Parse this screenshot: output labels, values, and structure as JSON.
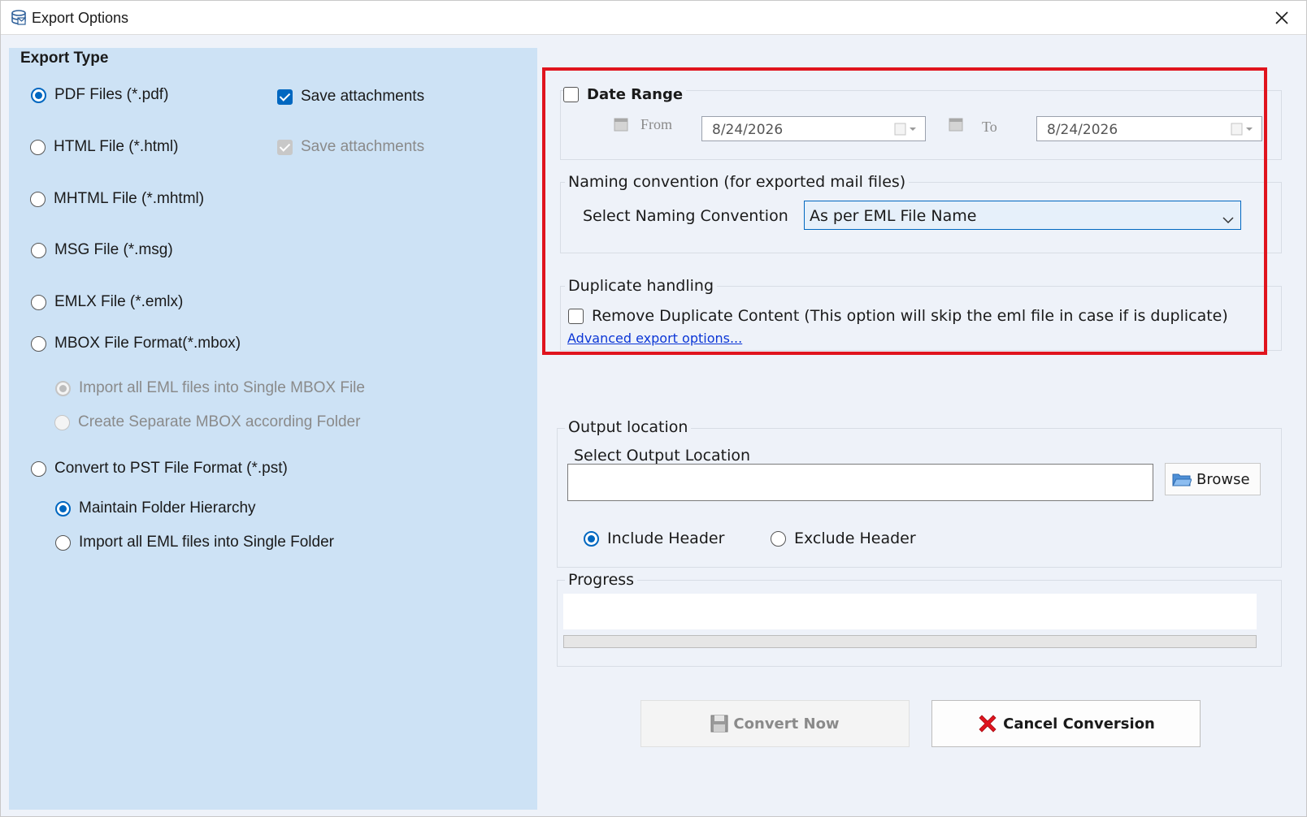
{
  "window": {
    "title": "Export Options"
  },
  "export_type": {
    "title": "Export Type",
    "pdf": {
      "label": "PDF Files (*.pdf)",
      "selected": true
    },
    "pdf_save_attachments": {
      "label": "Save attachments",
      "checked": true
    },
    "html": {
      "label": "HTML File  (*.html)",
      "selected": false
    },
    "html_save_attachments": {
      "label": "Save attachments",
      "checked": true,
      "disabled": true
    },
    "mhtml": {
      "label": "MHTML File  (*.mhtml)",
      "selected": false
    },
    "msg": {
      "label": "MSG File (*.msg)",
      "selected": false
    },
    "emlx": {
      "label": "EMLX File (*.emlx)",
      "selected": false
    },
    "mbox": {
      "label": "MBOX File Format(*.mbox)",
      "selected": false
    },
    "mbox_single": {
      "label": "Import all EML files into Single MBOX File",
      "selected": true,
      "disabled": true
    },
    "mbox_separate": {
      "label": "Create Separate MBOX according Folder",
      "selected": false,
      "disabled": true
    },
    "pst": {
      "label": "Convert to PST File Format (*.pst)",
      "selected": false
    },
    "pst_maintain": {
      "label": "Maintain Folder Hierarchy",
      "selected": true
    },
    "pst_single": {
      "label": "Import all EML files into Single Folder",
      "selected": false
    }
  },
  "date_range": {
    "label": "Date Range",
    "checked": false,
    "from_label": "From",
    "from_value": "8/24/2026",
    "to_label": "To",
    "to_value": "8/24/2026"
  },
  "naming": {
    "group_label": "Naming convention (for exported mail files)",
    "select_label": "Select Naming Convention",
    "selected_value": "As per EML File Name"
  },
  "duplicate": {
    "group_label": "Duplicate handling",
    "remove_label": "Remove Duplicate Content (This option will skip the eml file in case if is duplicate)",
    "checked": false,
    "advanced_link": "Advanced export options..."
  },
  "output": {
    "group_label": "Output location",
    "select_label": "Select Output Location",
    "path_value": "",
    "browse_label": "Browse",
    "include_header": {
      "label": "Include Header",
      "selected": true
    },
    "exclude_header": {
      "label": "Exclude Header",
      "selected": false
    }
  },
  "progress": {
    "group_label": "Progress",
    "percent": 0
  },
  "actions": {
    "convert_label": "Convert Now",
    "cancel_label": "Cancel Conversion"
  },
  "colors": {
    "left_panel_bg": "#cde2f5",
    "accent": "#0067c0",
    "highlight_border": "#e0141e",
    "cancel_icon": "#e0141e"
  }
}
